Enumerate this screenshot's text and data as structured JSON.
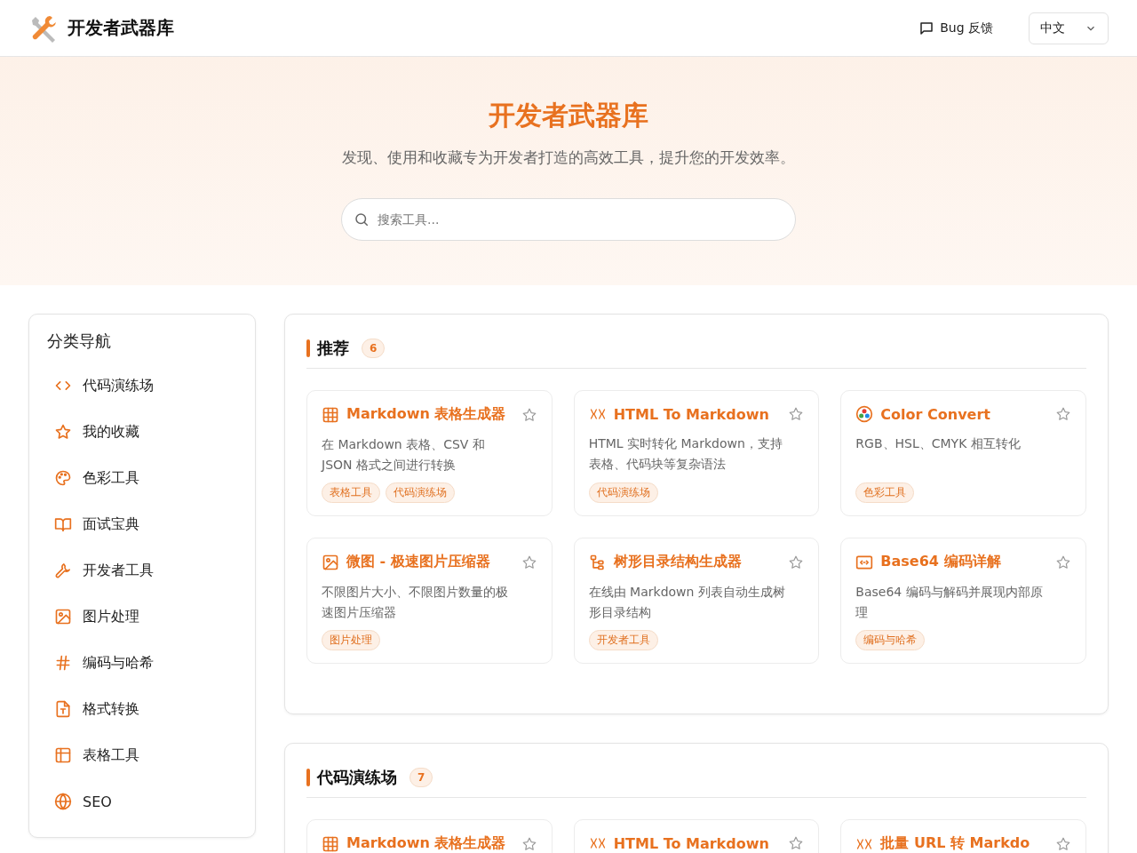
{
  "header": {
    "site_name": "开发者武器库",
    "feedback": "Bug 反馈",
    "language": "中文"
  },
  "hero": {
    "title": "开发者武器库",
    "subtitle": "发现、使用和收藏专为开发者打造的高效工具，提升您的开发效率。",
    "search": {
      "placeholder": "搜索工具..."
    }
  },
  "sidebar": {
    "title": "分类导航",
    "items": [
      {
        "label": "代码演练场"
      },
      {
        "label": "我的收藏"
      },
      {
        "label": "色彩工具"
      },
      {
        "label": "面试宝典"
      },
      {
        "label": "开发者工具"
      },
      {
        "label": "图片处理"
      },
      {
        "label": "编码与哈希"
      },
      {
        "label": "格式转换"
      },
      {
        "label": "表格工具"
      },
      {
        "label": "SEO"
      }
    ]
  },
  "sections": [
    {
      "title": "推荐",
      "count": "6",
      "tools": [
        {
          "title": "Markdown 表格生成器",
          "description": "在 Markdown 表格、CSV 和 JSON 格式之间进行转换",
          "tags": [
            "表格工具",
            "代码演练场"
          ]
        },
        {
          "title": "HTML To Markdown",
          "description": "HTML 实时转化 Markdown，支持表格、代码块等复杂语法",
          "tags": [
            "代码演练场"
          ]
        },
        {
          "title": "Color Convert",
          "description": "RGB、HSL、CMYK 相互转化",
          "tags": [
            "色彩工具"
          ]
        },
        {
          "title": "微图 - 极速图片压缩器",
          "description": "不限图片大小、不限图片数量的极速图片压缩器",
          "tags": [
            "图片处理"
          ]
        },
        {
          "title": "树形目录结构生成器",
          "description": "在线由 Markdown 列表自动生成树形目录结构",
          "tags": [
            "开发者工具"
          ]
        },
        {
          "title": "Base64 编码详解",
          "description": "Base64 编码与解码并展现内部原理",
          "tags": [
            "编码与哈希"
          ]
        }
      ]
    },
    {
      "title": "代码演练场",
      "count": "7",
      "tools": [
        {
          "title": "Markdown 表格生成器"
        },
        {
          "title": "HTML To Markdown"
        },
        {
          "title": "批量 URL 转 Markdo"
        }
      ]
    }
  ]
}
